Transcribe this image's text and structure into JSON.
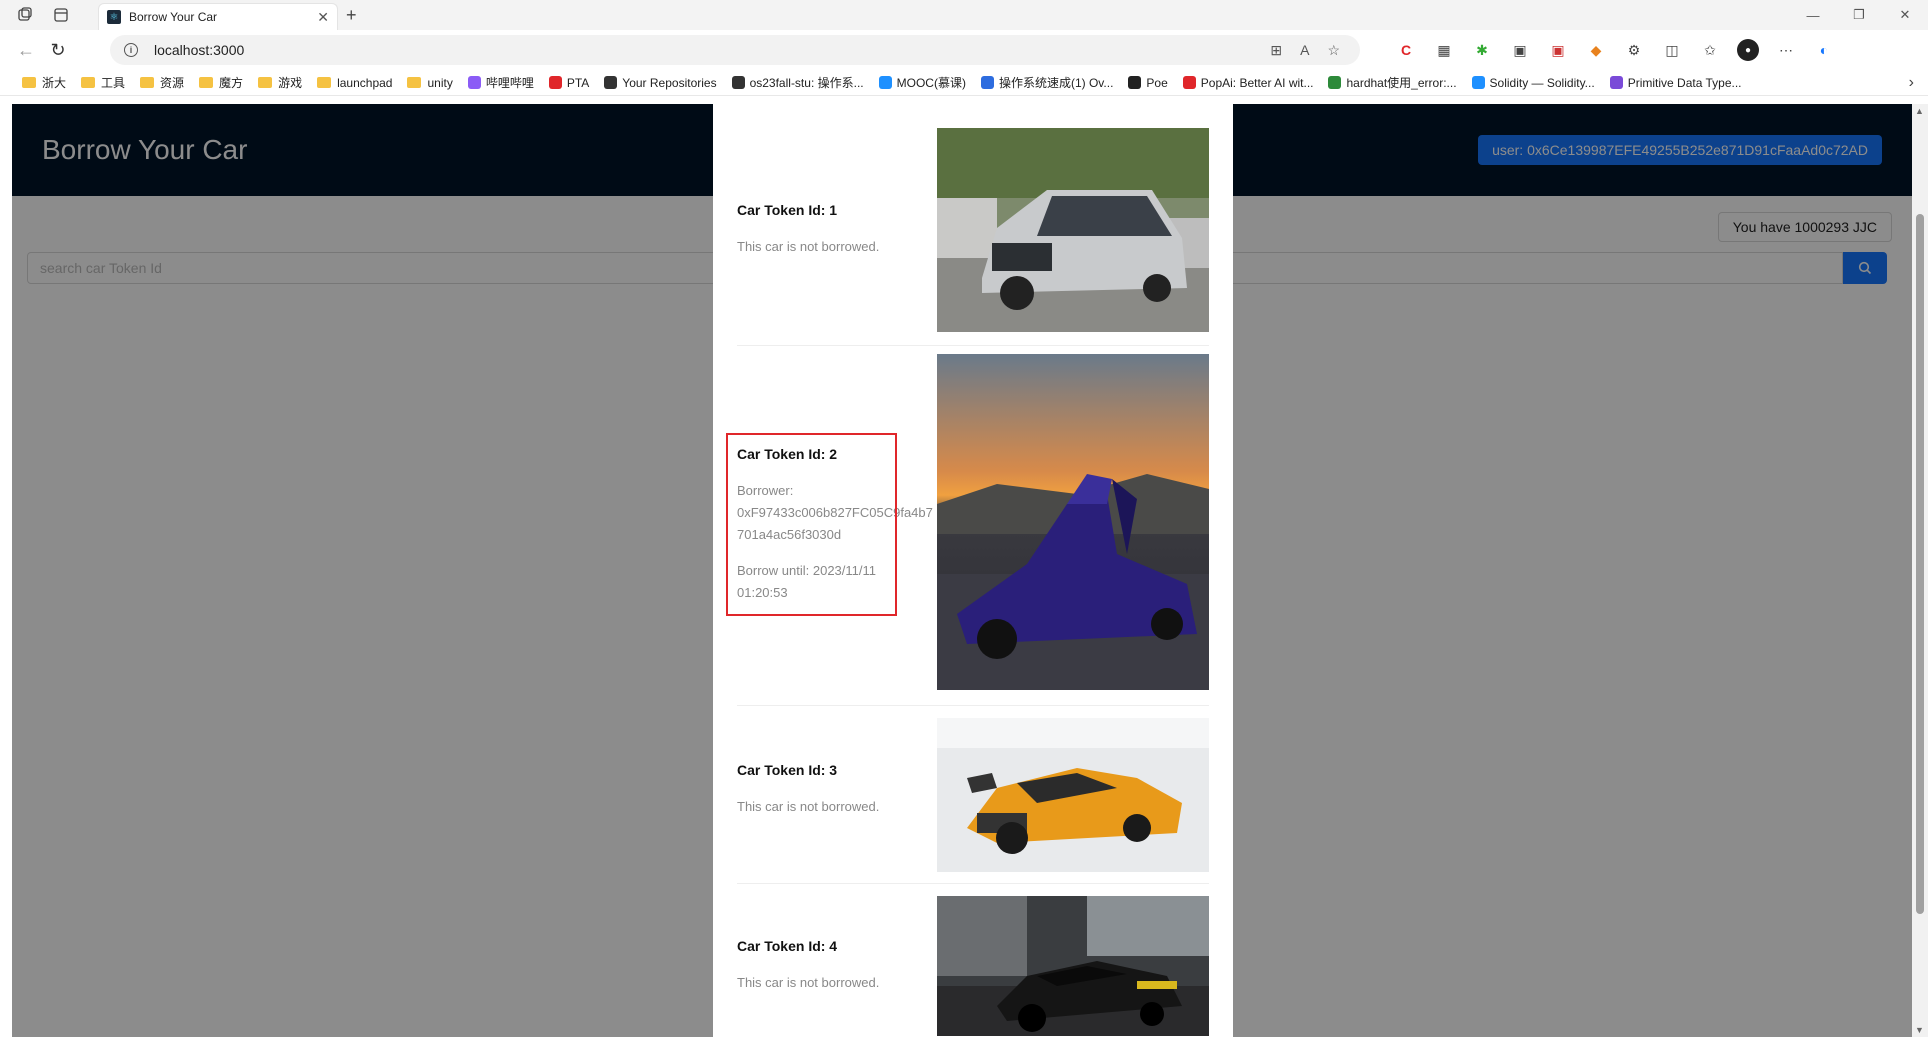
{
  "browser": {
    "tab_title": "Borrow Your Car",
    "url": "localhost:3000",
    "bookmarks": [
      {
        "label": "浙大",
        "kind": "folder"
      },
      {
        "label": "工具",
        "kind": "folder"
      },
      {
        "label": "资源",
        "kind": "folder"
      },
      {
        "label": "魔方",
        "kind": "folder"
      },
      {
        "label": "游戏",
        "kind": "folder"
      },
      {
        "label": "launchpad",
        "kind": "folder"
      },
      {
        "label": "unity",
        "kind": "folder"
      },
      {
        "label": "哔哩哔哩",
        "kind": "site"
      },
      {
        "label": "PTA",
        "kind": "site"
      },
      {
        "label": "Your Repositories",
        "kind": "site"
      },
      {
        "label": "os23fall-stu: 操作系...",
        "kind": "site"
      },
      {
        "label": "MOOC(慕课)",
        "kind": "site"
      },
      {
        "label": "操作系统速成(1) Ov...",
        "kind": "site"
      },
      {
        "label": "Poe",
        "kind": "site"
      },
      {
        "label": "PopAi: Better AI wit...",
        "kind": "site"
      },
      {
        "label": "hardhat使用_error:...",
        "kind": "site"
      },
      {
        "label": "Solidity — Solidity...",
        "kind": "site"
      },
      {
        "label": "Primitive Data Type...",
        "kind": "site"
      }
    ]
  },
  "app": {
    "logo": "Borrow Your Car",
    "user_button": "user: 0x6Ce139987EFE49255B252e871D91cFaaAd0c72AD",
    "balance": "You have 1000293 JJC",
    "search_placeholder": "search car Token Id"
  },
  "cars": [
    {
      "title": "Car Token Id: 1",
      "status": "This car is not borrowed.",
      "borrower_label": "",
      "borrower": "",
      "until": ""
    },
    {
      "title": "Car Token Id: 2",
      "status": "",
      "borrower_label": "Borrower:",
      "borrower": "0xF97433c006b827FC05C9fa4b7701a4ac56f3030d",
      "until": "Borrow until: 2023/11/11 01:20:53"
    },
    {
      "title": "Car Token Id: 3",
      "status": "This car is not borrowed.",
      "borrower_label": "",
      "borrower": "",
      "until": ""
    },
    {
      "title": "Car Token Id: 4",
      "status": "This car is not borrowed.",
      "borrower_label": "",
      "borrower": "",
      "until": ""
    }
  ],
  "colors": {
    "primary": "#1677ff",
    "header": "#001529",
    "highlight": "#e0262a"
  }
}
